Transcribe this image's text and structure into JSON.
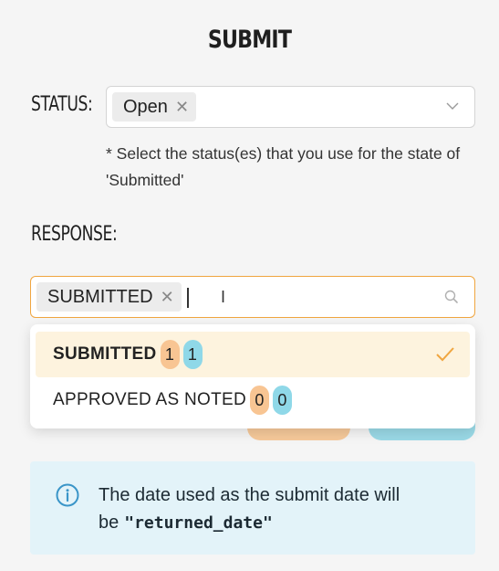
{
  "page": {
    "title": "SUBMIT"
  },
  "status": {
    "label": "STATUS:",
    "selected_tag": "Open",
    "hint": "* Select the status(es) that you use for the state of 'Submitted'"
  },
  "response": {
    "label": "RESPONSE:",
    "selected_tag": "SUBMITTED",
    "search_value": ""
  },
  "dropdown": {
    "options": [
      {
        "label": "SUBMITTED",
        "count_a": "1",
        "count_b": "1",
        "selected": true
      },
      {
        "label": "APPROVED AS NOTED",
        "count_a": "0",
        "count_b": "0",
        "selected": false
      }
    ]
  },
  "info": {
    "text": "The date used as the submit date will be",
    "field": "\"returned_date\""
  },
  "colors": {
    "accent_orange": "#f0a640",
    "badge_orange": "#f8c593",
    "badge_teal": "#8fd8e8",
    "info_bg": "#e3f3f9",
    "info_icon": "#3a95c8"
  },
  "icons": [
    "close-icon",
    "chevron-down-icon",
    "search-icon",
    "text-cursor-icon",
    "check-icon",
    "info-icon"
  ]
}
